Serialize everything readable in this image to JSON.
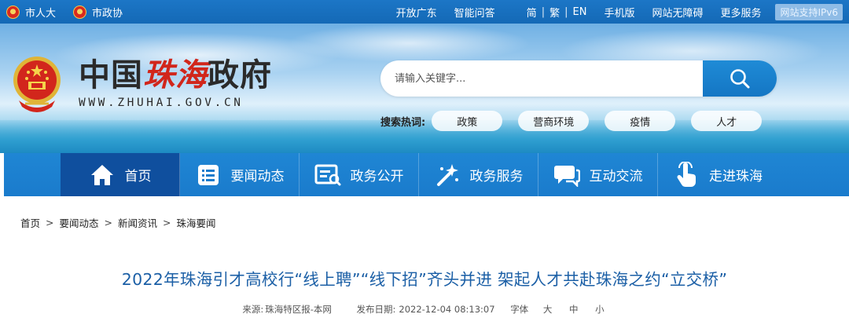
{
  "topbar": {
    "left_links": [
      {
        "label": "市人大",
        "icon": "emblem-icon"
      },
      {
        "label": "市政协",
        "icon": "cppcc-emblem-icon"
      }
    ],
    "right_links": [
      "开放广东",
      "智能问答"
    ],
    "languages": [
      "简",
      "繁",
      "EN"
    ],
    "more_links": [
      "手机版",
      "网站无障碍",
      "更多服务"
    ],
    "ipv6_badge": "网站支持IPv6"
  },
  "header": {
    "logo_prefix": "中国",
    "logo_city": "珠海",
    "logo_suffix": "政府",
    "logo_url": "WWW.ZHUHAI.GOV.CN",
    "search": {
      "placeholder": "请输入关键字..."
    },
    "hot_label": "搜索热词:",
    "hot_words": [
      "政策",
      "营商环境",
      "疫情",
      "人才"
    ]
  },
  "nav": {
    "items": [
      {
        "label": "首页",
        "icon": "home-icon"
      },
      {
        "label": "要闻动态",
        "icon": "news-list-icon"
      },
      {
        "label": "政务公开",
        "icon": "public-info-icon"
      },
      {
        "label": "政务服务",
        "icon": "service-magic-icon"
      },
      {
        "label": "互动交流",
        "icon": "chat-icon"
      },
      {
        "label": "走进珠海",
        "icon": "touch-hand-icon"
      }
    ]
  },
  "breadcrumb": [
    "首页",
    "要闻动态",
    "新闻资讯",
    "珠海要闻"
  ],
  "article": {
    "title": "2022年珠海引才高校行“线上聘”“线下招”齐头并进 架起人才共赴珠海之约“立交桥”",
    "source_label": "来源:",
    "source": "珠海特区报-本网",
    "date_label": "发布日期:",
    "date": "2022-12-04 08:13:07",
    "font_label": "字体",
    "font_sizes": [
      "大",
      "中",
      "小"
    ]
  },
  "colors": {
    "topbar": "#1469b6",
    "nav": "#1a7bcc",
    "nav_active": "#0f4f9e",
    "title": "#1b5fa6",
    "logo_red": "#d1261b"
  }
}
